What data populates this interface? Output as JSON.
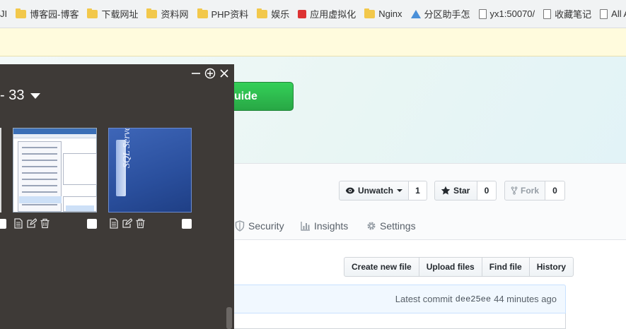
{
  "bookmarks": [
    {
      "label": "JI",
      "icon": "none"
    },
    {
      "label": "博客园-博客",
      "icon": "folder-icon"
    },
    {
      "label": "下载网址",
      "icon": "folder-icon"
    },
    {
      "label": "资料网",
      "icon": "folder-icon"
    },
    {
      "label": "PHP资料",
      "icon": "folder-icon"
    },
    {
      "label": "娱乐",
      "icon": "folder-icon"
    },
    {
      "label": "应用虚拟化",
      "icon": "app-icon"
    },
    {
      "label": "Nginx",
      "icon": "folder-icon"
    },
    {
      "label": "分区助手怎",
      "icon": "triangle-icon"
    },
    {
      "label": "yx1:50070/",
      "icon": "page-icon"
    },
    {
      "label": "收藏笔记",
      "icon": "page-icon"
    },
    {
      "label": "All Applica",
      "icon": "page-icon"
    }
  ],
  "hero": {
    "guide_label": "uide"
  },
  "repo_actions": {
    "watch_label": "Unwatch",
    "watch_count": "1",
    "star_label": "Star",
    "star_count": "0",
    "fork_label": "Fork",
    "fork_count": "0"
  },
  "nav_tabs": [
    {
      "label": "Security",
      "icon": "shield-icon"
    },
    {
      "label": "Insights",
      "icon": "graph-icon"
    },
    {
      "label": "Settings",
      "icon": "gear-icon"
    }
  ],
  "file_actions": [
    "Create new file",
    "Upload files",
    "Find file",
    "History"
  ],
  "commit": {
    "prefix": "Latest commit",
    "sha": "dee25ee",
    "time": "44 minutes ago"
  },
  "panel": {
    "title": "- 33",
    "thumb2_caption": "SQL Server Profiler"
  },
  "colors": {
    "panel_bg": "#3e3a37",
    "guide_green": "#28a745",
    "notice_bg": "#fffbdd"
  }
}
